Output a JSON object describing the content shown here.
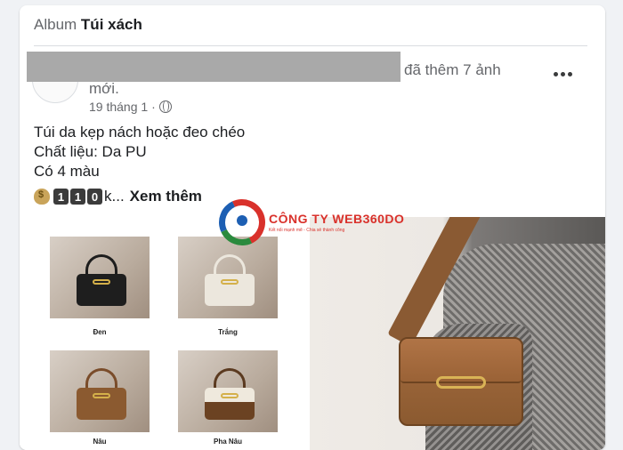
{
  "album": {
    "prefix": "Album",
    "name": "Túi xách"
  },
  "post": {
    "action_text": "đã thêm 7 ảnh mới.",
    "date": "19 tháng 1",
    "separator": "·",
    "visibility_icon": "globe-icon",
    "more_icon": "more-horizontal-icon",
    "lines": [
      "Túi da kẹp nách hoặc đeo chéo",
      "Chất liệu: Da PU",
      "Có 4 màu"
    ],
    "price_prefix_icon": "money-bag-icon",
    "price_digits": [
      "1",
      "1",
      "0"
    ],
    "price_suffix": "k...",
    "see_more": "Xem thêm"
  },
  "collage": {
    "labels": [
      "Đen",
      "Trắng",
      "Nâu",
      "Pha Nâu"
    ]
  },
  "watermark": {
    "name": "CÔNG TY WEB360DO",
    "tagline": "Kết nối mạnh mẽ - Chia sẻ thành công"
  },
  "colors": {
    "link": "#1c1e21",
    "secondary_text": "#65676b",
    "watermark_red": "#d9312b"
  }
}
